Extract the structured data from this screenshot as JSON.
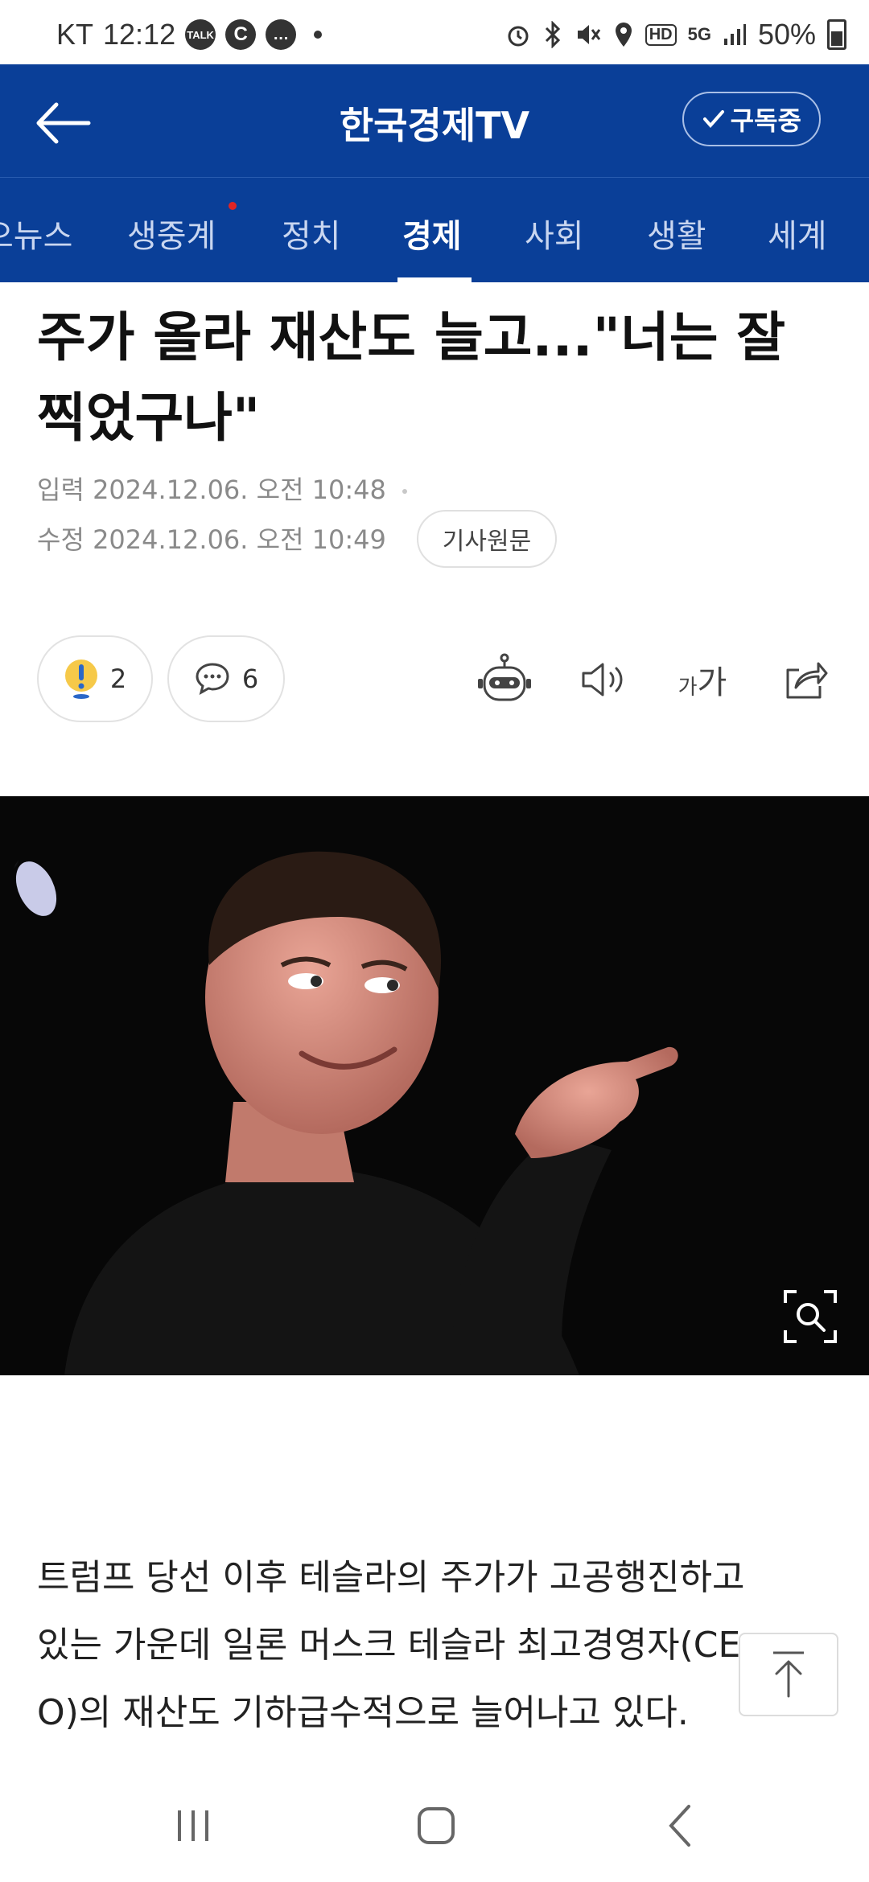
{
  "status_bar": {
    "carrier": "KT",
    "time": "12:12",
    "notif_icons": [
      "TALK",
      "C",
      "…"
    ],
    "right_icons": [
      "alarm-icon",
      "bluetooth-icon",
      "mute-icon",
      "location-icon"
    ],
    "hd_label": "HD",
    "network_label": "5G",
    "battery": "50%"
  },
  "header": {
    "title": "한국경제TV",
    "subscribe_label": "구독중"
  },
  "tabs": [
    {
      "label": "오뉴스",
      "active": false,
      "has_dot": false
    },
    {
      "label": "생중계",
      "active": false,
      "has_dot": true
    },
    {
      "label": "정치",
      "active": false,
      "has_dot": false
    },
    {
      "label": "경제",
      "active": true,
      "has_dot": false
    },
    {
      "label": "사회",
      "active": false,
      "has_dot": false
    },
    {
      "label": "생활",
      "active": false,
      "has_dot": false
    },
    {
      "label": "세계",
      "active": false,
      "has_dot": false
    }
  ],
  "article": {
    "headline_line1": "주가 올라 재산도 늘고...\"너는 잘",
    "headline_line2": "찍었구나\"",
    "input_label": "입력",
    "input_datetime": "2024.12.06. 오전 10:48",
    "edit_label": "수정",
    "edit_datetime": "2024.12.06. 오전 10:49",
    "original_label": "기사원문",
    "reaction_count": "2",
    "comment_count": "6",
    "font_size_small": "가",
    "font_size_large": "가",
    "body_line1": "트럼프 당선 이후 테슬라의 주가가 고공행진하고",
    "body_line2": "있는 가운데 일론 머스크 테슬라 최고경영자(CE",
    "body_line3": "O)의 재산도 기하급수적으로 늘어나고 있다."
  },
  "colors": {
    "brand": "#0a3f98",
    "accent_dot": "#e02424"
  }
}
